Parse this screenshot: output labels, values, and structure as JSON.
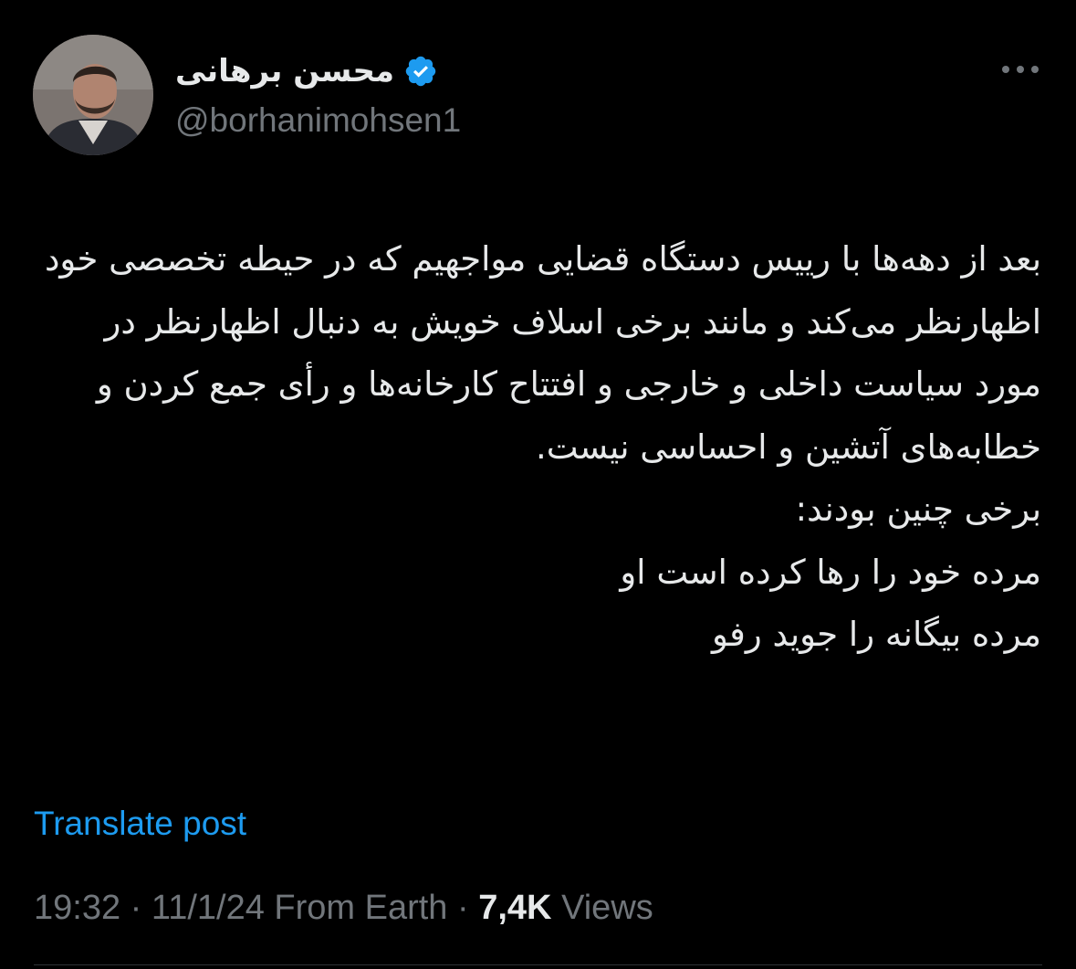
{
  "author": {
    "display_name": "محسن برهانی",
    "handle": "@borhanimohsen1",
    "verified": true,
    "verified_color": "#1d9bf0"
  },
  "tweet": {
    "text": "بعد از دهه‌ها با رییس دستگاه قضایی مواجهیم که در حیطه تخصصی خود اظهارنظر می‌کند و مانند برخی اسلاف خویش به دنبال اظهارنظر در مورد سیاست داخلی و خارجی و افتتاح کارخانه‌ها و رأی جمع کردن و خطابه‌های آتشین و احساسی نیست.\nبرخی چنین بودند:\nمرده خود را رها کرده است او\nمرده بیگانه را جوید رفو",
    "translate_label": "Translate post"
  },
  "meta": {
    "time": "19:32",
    "date": "11/1/24",
    "source": "From Earth",
    "views_count": "7,4K",
    "views_label": "Views"
  },
  "icons": {
    "more": "more-horizontal-icon",
    "verified": "verified-badge-icon"
  },
  "colors": {
    "background": "#000000",
    "text_primary": "#e7e9ea",
    "text_secondary": "#71767b",
    "accent": "#1d9bf0"
  }
}
